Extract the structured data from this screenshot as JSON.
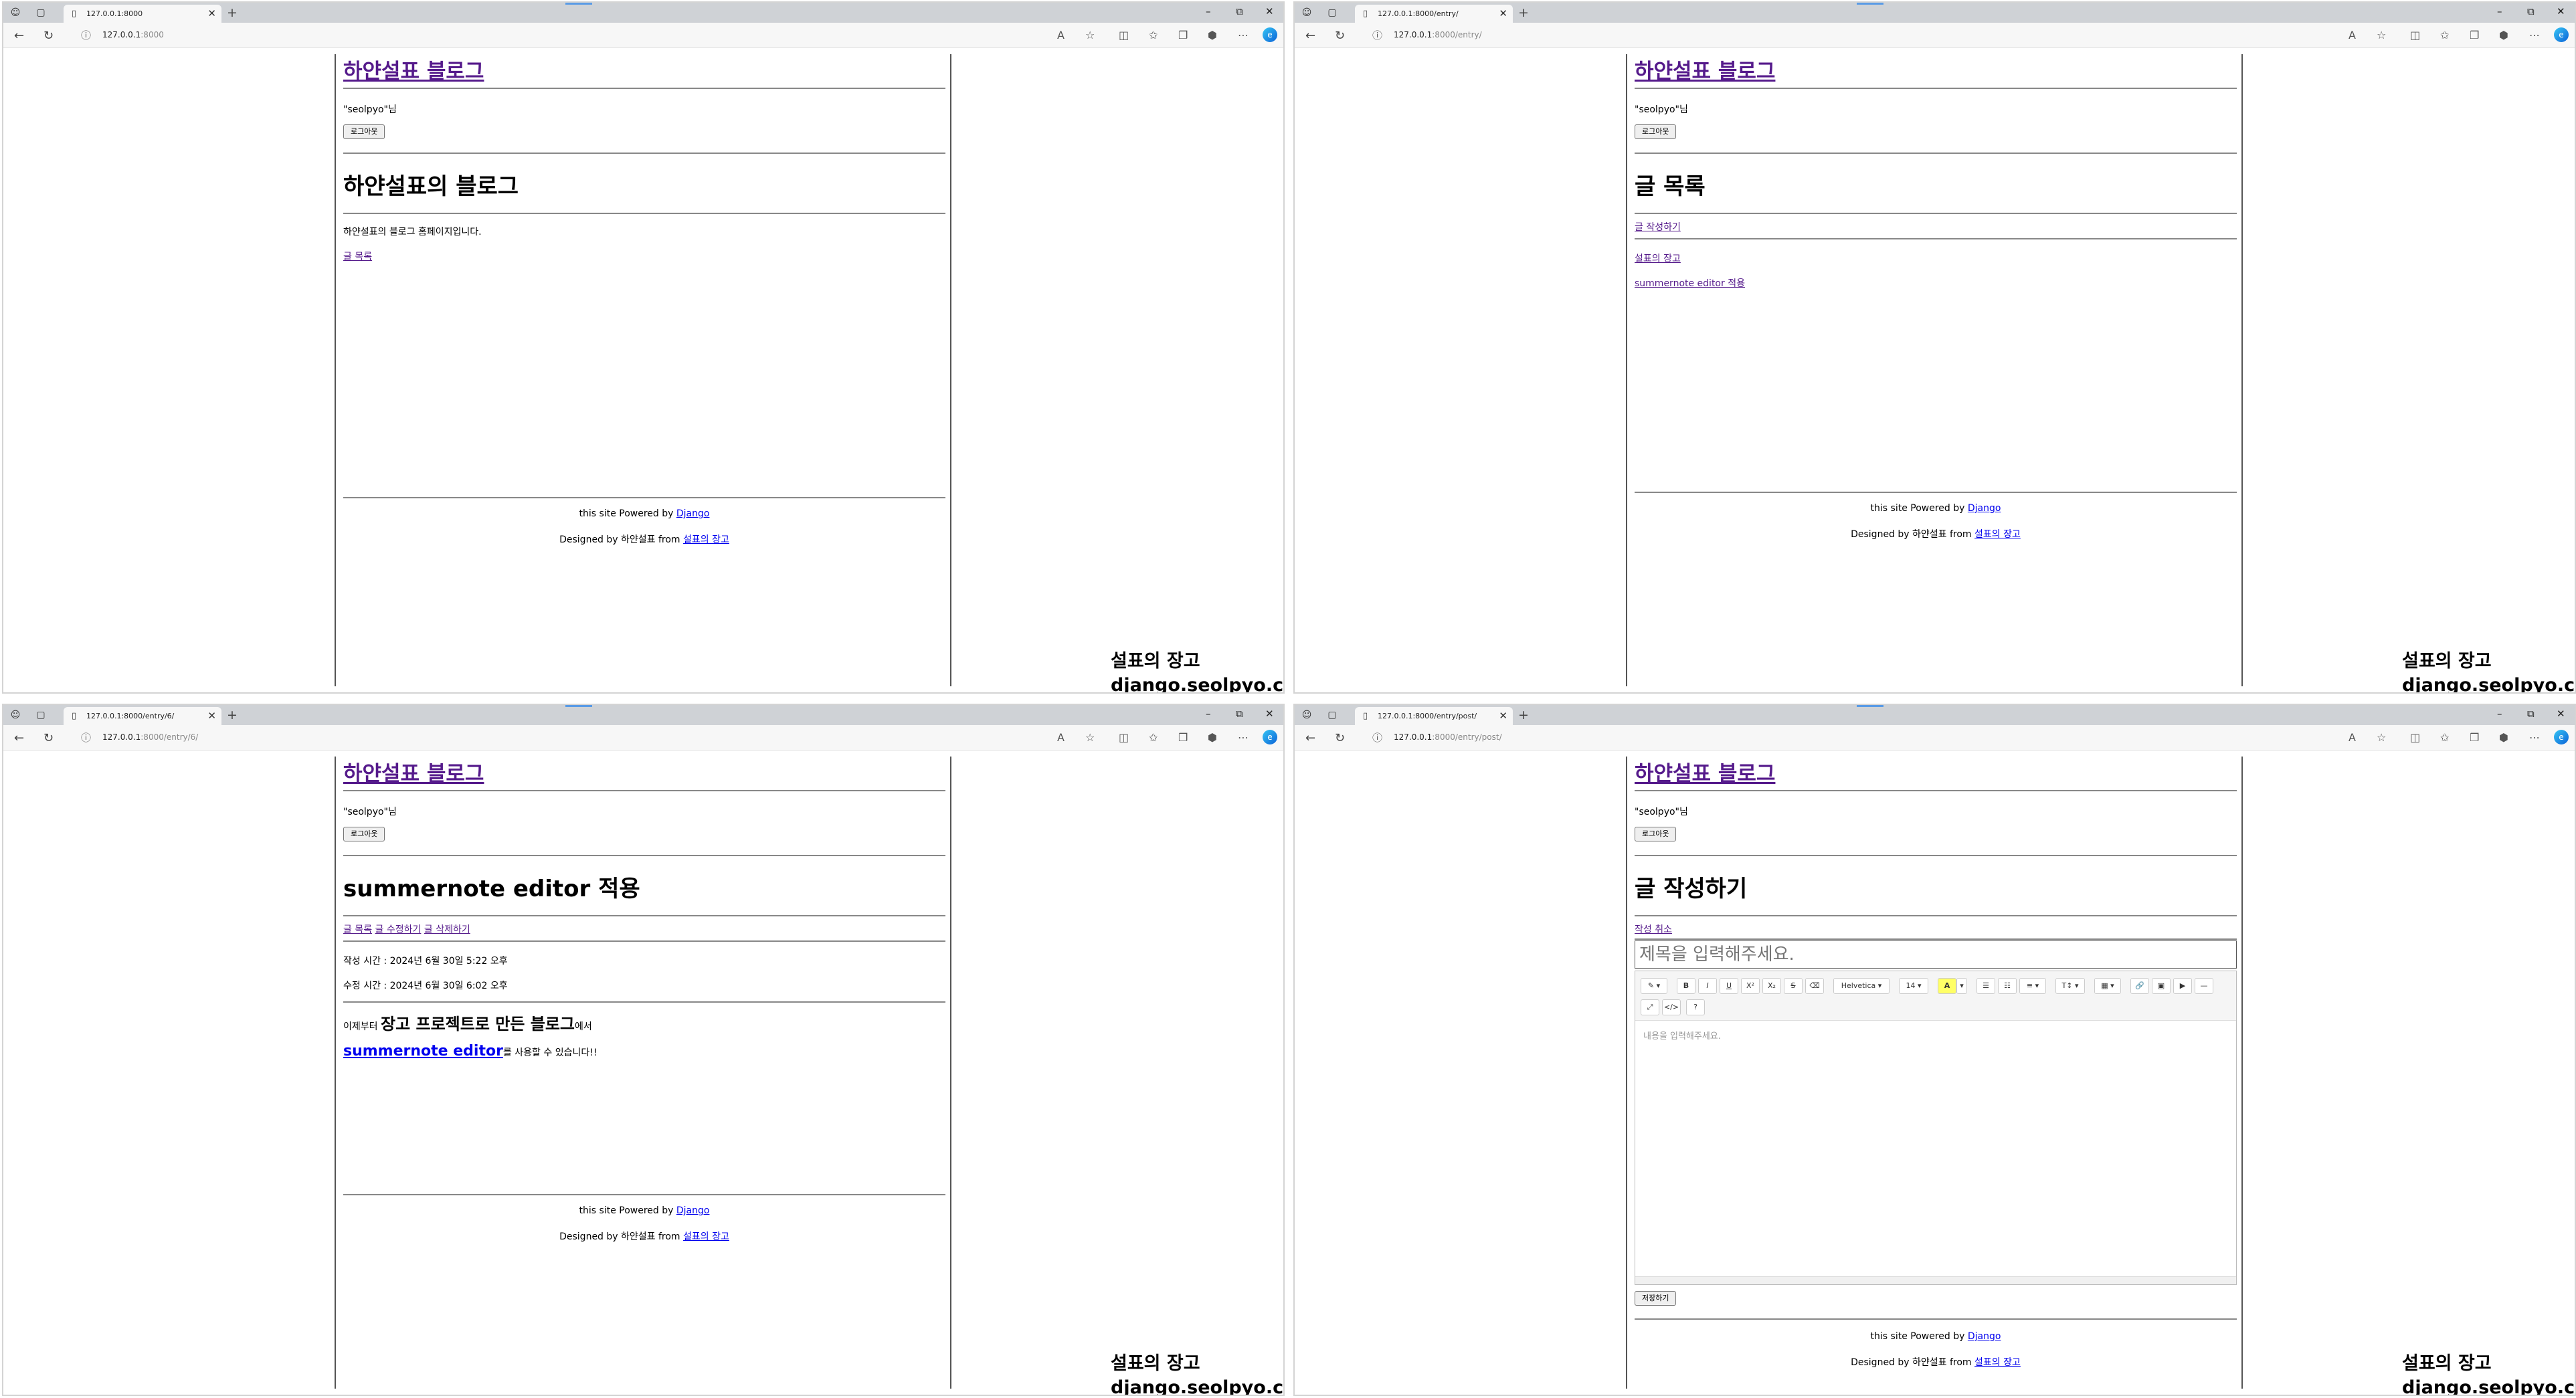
{
  "browser": {
    "new_tab_glyph": "+",
    "close_glyph": "✕",
    "minimize_glyph": "–",
    "restore_glyph": "⧉",
    "tab_icon": "page-icon",
    "ctrl_icons": [
      "minimize-icon",
      "restore-icon",
      "close-icon"
    ]
  },
  "windows": [
    {
      "tab_title": "127.0.0.1:8000",
      "url_host": "127.0.0.1",
      "url_path": ":8000"
    },
    {
      "tab_title": "127.0.0.1:8000/entry/",
      "url_host": "127.0.0.1",
      "url_path": ":8000/entry/"
    },
    {
      "tab_title": "127.0.0.1:8000/entry/6/",
      "url_host": "127.0.0.1",
      "url_path": ":8000/entry/6/"
    },
    {
      "tab_title": "127.0.0.1:8000/entry/post/",
      "url_host": "127.0.0.1",
      "url_path": ":8000/entry/post/"
    }
  ],
  "site": {
    "blog_title": "하얀설표 블로그",
    "user_greeting": "\"seolpyo\"님",
    "logout_button": "로그아웃",
    "footer_powered_prefix": "this site Powered by ",
    "footer_powered_link": "Django",
    "footer_designed_prefix": "Designed by 하얀설표 from ",
    "footer_designed_link": "설표의 장고"
  },
  "home": {
    "heading": "하얀설표의 블로그",
    "intro": "하얀설표의 블로그 홈페이지입니다.",
    "list_link": "글 목록"
  },
  "entry_list": {
    "heading": "글 목록",
    "write_link": "글 작성하기",
    "entries": [
      "설표의 장고",
      "summernote editor 적용"
    ]
  },
  "entry_detail": {
    "heading": "summernote editor 적용",
    "links": [
      "글 목록",
      "글 수정하기",
      "글 삭제하기"
    ],
    "created": "작성 시간 : 2024년 6월 30일 5:22 오후",
    "modified": "수정 시간 : 2024년 6월 30일 6:02 오후",
    "body_line1_prefix": "이제부터 ",
    "body_line1_bold": "장고 프로젝트로 만든 블로그",
    "body_line1_suffix": "에서",
    "body_line2_link": "summernote editor",
    "body_line2_suffix": "를 사용할 수 있습니다!!"
  },
  "entry_post": {
    "heading": "글 작성하기",
    "cancel_link": "작성 취소",
    "title_placeholder": "제목을 입력해주세요.",
    "body_placeholder": "내용을 입력해주세요.",
    "save_button": "저장하기",
    "toolbar": {
      "style": "✎ ▾",
      "bold": "B",
      "italic": "I",
      "underline": "U",
      "superscript": "X²",
      "subscript": "X₂",
      "strike": "S",
      "eraser": "⌫",
      "font_name": "Helvetica ▾",
      "font_size": "14 ▾",
      "color": "A",
      "color_dd": "▾",
      "ul": "☰",
      "ol": "☷",
      "para": "≡ ▾",
      "height": "T↕ ▾",
      "table": "▦ ▾",
      "link": "🔗",
      "picture": "▣",
      "video": "▶",
      "hr": "—",
      "fullscreen": "⤢",
      "code": "</>",
      "help": "?"
    }
  },
  "watermark": {
    "line1": "설표의 장고",
    "line2": "django.seolpyo.com"
  }
}
